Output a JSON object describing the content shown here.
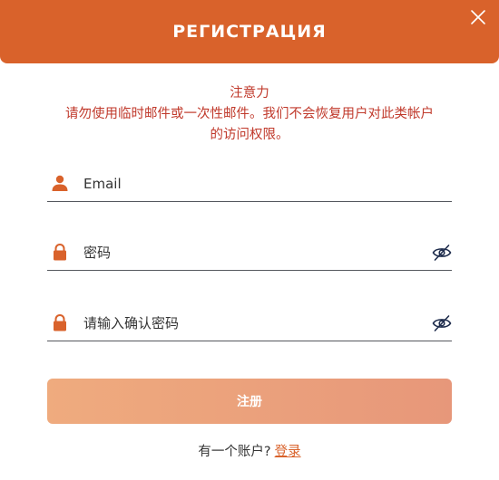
{
  "header": {
    "title": "РЕГИСТРАЦИЯ",
    "background_color": "#d9622b",
    "close_icon": "close-icon"
  },
  "notice": {
    "heading": "注意力",
    "line1": "请勿使用临时邮件或一次性邮件。我们不会恢复用户对此类帐户",
    "line2": "的访问权限。",
    "color": "#c0392b"
  },
  "form": {
    "email": {
      "placeholder": "Email",
      "icon": "user-icon"
    },
    "password": {
      "placeholder": "密码",
      "icon": "lock-icon",
      "toggle_icon": "eye-off-icon"
    },
    "confirm_password": {
      "placeholder": "请输入确认密码",
      "icon": "lock-icon",
      "toggle_icon": "eye-off-icon"
    },
    "submit_label": "注册",
    "accent_color": "#d9622b"
  },
  "footer": {
    "prompt": "有一个账户?",
    "login_link": "登录"
  }
}
